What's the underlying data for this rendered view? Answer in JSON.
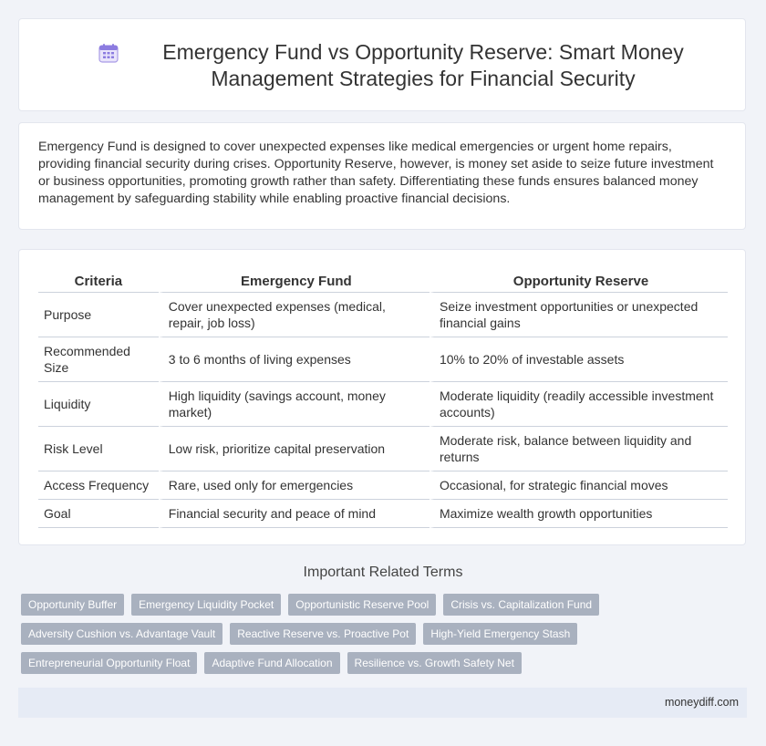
{
  "header": {
    "icon": "calendar-icon",
    "title": "Emergency Fund vs Opportunity Reserve: Smart Money Management Strategies for Financial Security"
  },
  "intro": {
    "text": "Emergency Fund is designed to cover unexpected expenses like medical emergencies or urgent home repairs, providing financial security during crises. Opportunity Reserve, however, is money set aside to seize future investment or business opportunities, promoting growth rather than safety. Differentiating these funds ensures balanced money management by safeguarding stability while enabling proactive financial decisions."
  },
  "table": {
    "headers": [
      "Criteria",
      "Emergency Fund",
      "Opportunity Reserve"
    ],
    "rows": [
      [
        "Purpose",
        "Cover unexpected expenses (medical, repair, job loss)",
        "Seize investment opportunities or unexpected financial gains"
      ],
      [
        "Recommended Size",
        "3 to 6 months of living expenses",
        "10% to 20% of investable assets"
      ],
      [
        "Liquidity",
        "High liquidity (savings account, money market)",
        "Moderate liquidity (readily accessible investment accounts)"
      ],
      [
        "Risk Level",
        "Low risk, prioritize capital preservation",
        "Moderate risk, balance between liquidity and returns"
      ],
      [
        "Access Frequency",
        "Rare, used only for emergencies",
        "Occasional, for strategic financial moves"
      ],
      [
        "Goal",
        "Financial security and peace of mind",
        "Maximize wealth growth opportunities"
      ]
    ]
  },
  "related": {
    "heading": "Important Related Terms",
    "tags": [
      "Opportunity Buffer",
      "Emergency Liquidity Pocket",
      "Opportunistic Reserve Pool",
      "Crisis vs. Capitalization Fund",
      "Adversity Cushion vs. Advantage Vault",
      "Reactive Reserve vs. Proactive Pot",
      "High-Yield Emergency Stash",
      "Entrepreneurial Opportunity Float",
      "Adaptive Fund Allocation",
      "Resilience vs. Growth Safety Net"
    ]
  },
  "footer": {
    "text": "moneydiff.com"
  },
  "colors": {
    "background": "#f1f3f8",
    "tag": "#a9b1bf",
    "footer": "#e6ebf5"
  }
}
